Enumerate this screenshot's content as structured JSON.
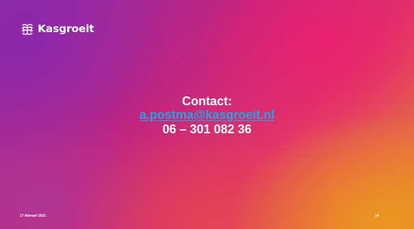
{
  "slide": {
    "logo": {
      "icon": "kasgroeit-plant-logo-icon",
      "name": "Kasgroeit"
    },
    "contact": {
      "heading": "Contact:",
      "email": "a.postma@kasgroeit.nl",
      "phone": "06 – 301 082 36"
    },
    "footer": {
      "date": "17 februari 2021",
      "page_number": "14"
    },
    "colors": {
      "text": "#ffffff",
      "link": "#1ea6e6",
      "gradient_purple": "#8e2bab",
      "gradient_magenta": "#c2257f",
      "gradient_pink": "#e2336a",
      "gradient_orange": "#e9892f"
    }
  }
}
